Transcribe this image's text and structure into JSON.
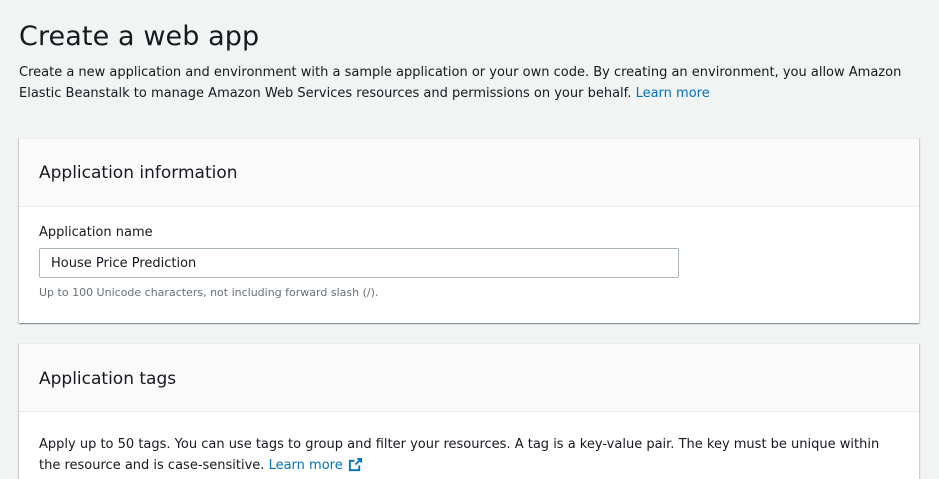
{
  "header": {
    "title": "Create a web app",
    "description": "Create a new application and environment with a sample application or your own code. By creating an environment, you allow Amazon Elastic Beanstalk to manage Amazon Web Services resources and permissions on your behalf.",
    "learn_more": "Learn more"
  },
  "application_information": {
    "title": "Application information",
    "name_label": "Application name",
    "name_value": "House Price Prediction",
    "name_hint": "Up to 100 Unicode characters, not including forward slash (/)."
  },
  "application_tags": {
    "title": "Application tags",
    "description": "Apply up to 50 tags. You can use tags to group and filter your resources. A tag is a key-value pair. The key must be unique within the resource and is case-sensitive.",
    "learn_more": "Learn more",
    "learn_more_icon": "external-link-icon"
  },
  "colors": {
    "link": "#0073bb",
    "background": "#f2f3f3",
    "panel_header": "#fafafa"
  }
}
